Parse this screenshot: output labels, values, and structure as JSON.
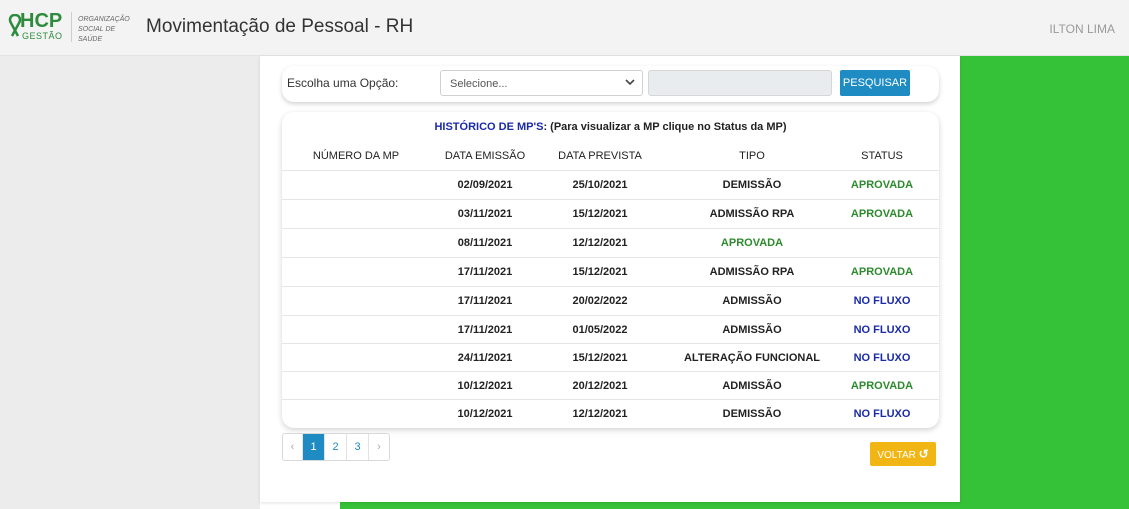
{
  "header": {
    "logo_text": "HCP",
    "logo_sub": "GESTÃO",
    "org_line1": "ORGANIZAÇÃO",
    "org_line2": "SOCIAL DE SAÚDE",
    "title": "Movimentação de Pessoal - RH",
    "user": "ILTON LIMA"
  },
  "filter": {
    "label": "Escolha uma Opção:",
    "select_value": "Selecione...",
    "search_value": "",
    "search_button": "PESQUISAR"
  },
  "table": {
    "caption_highlight": "HISTÓRICO DE MP'S",
    "caption_rest": ": (Para visualizar a MP clique no Status da MP)",
    "columns": [
      "NÚMERO DA MP",
      "DATA EMISSÃO",
      "DATA PREVISTA",
      "TIPO",
      "STATUS"
    ],
    "rows": [
      {
        "numero": "",
        "emissao": "02/09/2021",
        "prevista": "25/10/2021",
        "tipo": "DEMISSÃO",
        "status": "APROVADA"
      },
      {
        "numero": "",
        "emissao": "03/11/2021",
        "prevista": "15/12/2021",
        "tipo": "ADMISSÃO RPA",
        "status": "APROVADA"
      },
      {
        "numero": "",
        "emissao": "08/11/2021",
        "prevista": "12/12/2021",
        "tipo": "APROVADA",
        "status": ""
      },
      {
        "numero": "",
        "emissao": "17/11/2021",
        "prevista": "15/12/2021",
        "tipo": "ADMISSÃO RPA",
        "status": "APROVADA"
      },
      {
        "numero": "",
        "emissao": "17/11/2021",
        "prevista": "20/02/2022",
        "tipo": "ADMISSÃO",
        "status": "NO FLUXO"
      },
      {
        "numero": "",
        "emissao": "17/11/2021",
        "prevista": "01/05/2022",
        "tipo": "ADMISSÃO",
        "status": "NO FLUXO"
      },
      {
        "numero": "",
        "emissao": "24/11/2021",
        "prevista": "15/12/2021",
        "tipo": "ALTERAÇÃO FUNCIONAL",
        "status": "NO FLUXO"
      },
      {
        "numero": "",
        "emissao": "10/12/2021",
        "prevista": "20/12/2021",
        "tipo": "ADMISSÃO",
        "status": "APROVADA"
      },
      {
        "numero": "",
        "emissao": "10/12/2021",
        "prevista": "12/12/2021",
        "tipo": "DEMISSÃO",
        "status": "NO FLUXO"
      }
    ]
  },
  "pagination": {
    "prev": "‹",
    "pages": [
      "1",
      "2",
      "3"
    ],
    "active_page": "1",
    "next": "›"
  },
  "back_button": {
    "label": "VOLTAR",
    "icon": "undo-icon",
    "color": "#f2b614"
  },
  "colors": {
    "accent_blue": "#1e8bc3",
    "status_green": "#2d8a2d",
    "status_blue": "#1a2aa8",
    "side_green": "#36c238"
  }
}
